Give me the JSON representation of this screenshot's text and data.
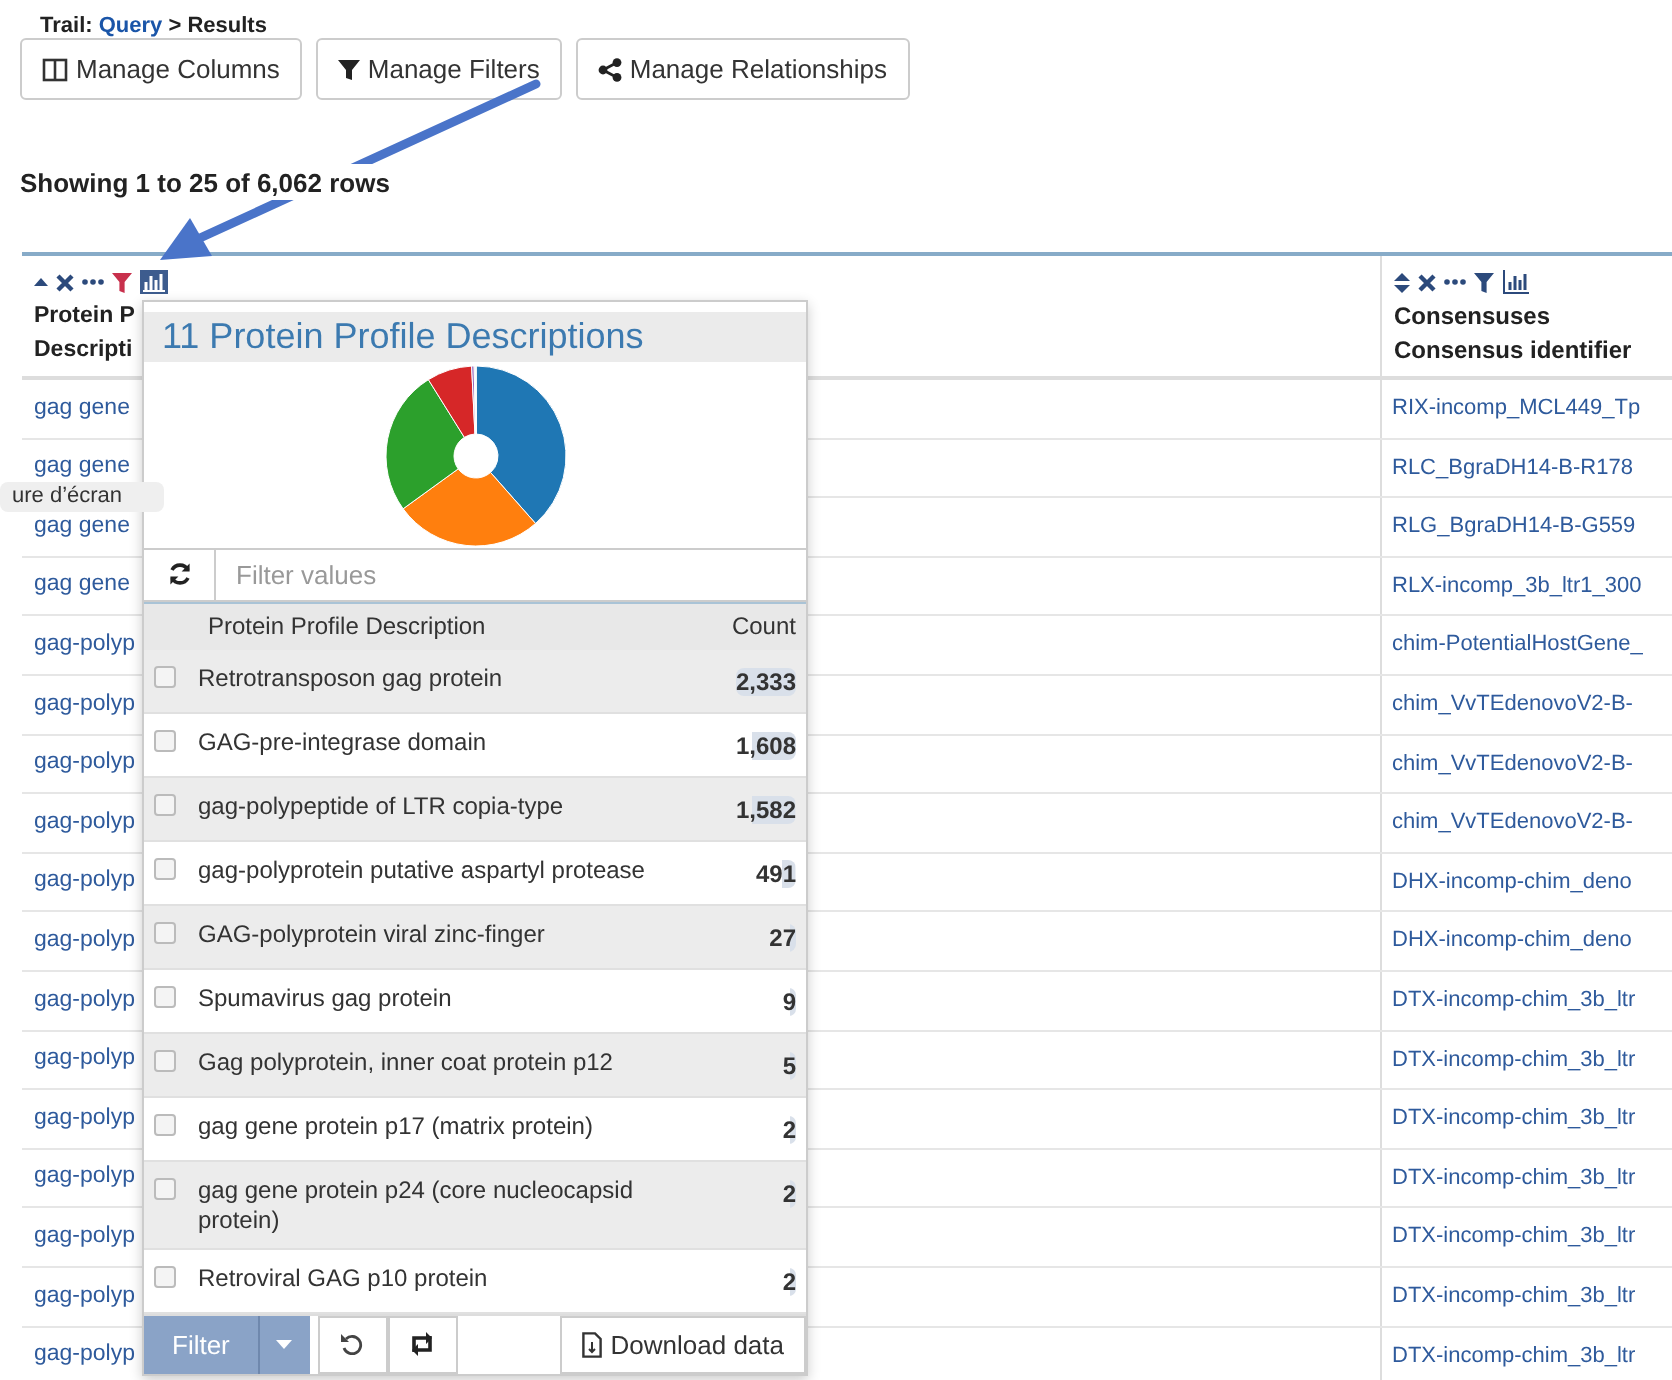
{
  "breadcrumb": {
    "label": "Trail:",
    "link": "Query",
    "separator": ">",
    "current": "Results"
  },
  "toolbar": [
    {
      "label": "Manage Columns"
    },
    {
      "label": "Manage Filters"
    },
    {
      "label": "Manage Relationships"
    }
  ],
  "summary": "Showing 1 to 25 of 6,062 rows",
  "table": {
    "columns": [
      {
        "title": "Protein P",
        "subtitle": "Descripti",
        "filtered": true,
        "chart_open": true
      },
      {
        "title": "Consensuses",
        "subtitle": "Consensus identifier",
        "filtered": false,
        "chart_open": false
      }
    ],
    "rows": [
      [
        "gag gene",
        "RIX-incomp_MCL449_Tp"
      ],
      [
        "gag gene",
        "RLC_BgraDH14-B-R178"
      ],
      [
        "gag gene",
        "RLG_BgraDH14-B-G559"
      ],
      [
        "gag gene",
        "RLX-incomp_3b_ltr1_300"
      ],
      [
        "gag-polyp",
        "chim-PotentialHostGene_"
      ],
      [
        "gag-polyp",
        "chim_VvTEdenovoV2-B-"
      ],
      [
        "gag-polyp",
        "chim_VvTEdenovoV2-B-"
      ],
      [
        "gag-polyp",
        "chim_VvTEdenovoV2-B-"
      ],
      [
        "gag-polyp",
        "DHX-incomp-chim_deno"
      ],
      [
        "gag-polyp",
        "DHX-incomp-chim_deno"
      ],
      [
        "gag-polyp",
        "DTX-incomp-chim_3b_ltr"
      ],
      [
        "gag-polyp",
        "DTX-incomp-chim_3b_ltr"
      ],
      [
        "gag-polyp",
        "DTX-incomp-chim_3b_ltr"
      ],
      [
        "gag-polyp",
        "DTX-incomp-chim_3b_ltr"
      ],
      [
        "gag-polyp",
        "DTX-incomp-chim_3b_ltr"
      ],
      [
        "gag-polyp",
        "DTX-incomp-chim_3b_ltr"
      ],
      [
        "gag-polyp",
        "DTX-incomp-chim_3b_ltr"
      ]
    ]
  },
  "tooltip": "ure d’écran",
  "popup": {
    "title": "11 Protein Profile Descriptions",
    "filter_placeholder": "Filter values",
    "columns": [
      "Protein Profile Description",
      "Count"
    ],
    "items": [
      {
        "label": "Retrotransposon gag protein",
        "count": "2,333",
        "checked": false
      },
      {
        "label": "GAG-pre-integrase domain",
        "count": "1,608",
        "checked": false
      },
      {
        "label": "gag-polypeptide of LTR copia-type",
        "count": "1,582",
        "checked": false
      },
      {
        "label": "gag-polyprotein putative aspartyl protease",
        "count": "491",
        "checked": false
      },
      {
        "label": "GAG-polyprotein viral zinc-finger",
        "count": "27",
        "checked": false
      },
      {
        "label": "Spumavirus gag protein",
        "count": "9",
        "checked": false
      },
      {
        "label": "Gag polyprotein, inner coat protein p12",
        "count": "5",
        "checked": false
      },
      {
        "label": "gag gene protein p17 (matrix protein)",
        "count": "2",
        "checked": false
      },
      {
        "label": "gag gene protein p24 (core nucleocapsid protein)",
        "count": "2",
        "checked": false
      },
      {
        "label": "Retroviral GAG p10 protein",
        "count": "2",
        "checked": false
      }
    ],
    "filter_button": {
      "label": "Filter",
      "disabled": true
    },
    "download_button": "Download data"
  }
}
